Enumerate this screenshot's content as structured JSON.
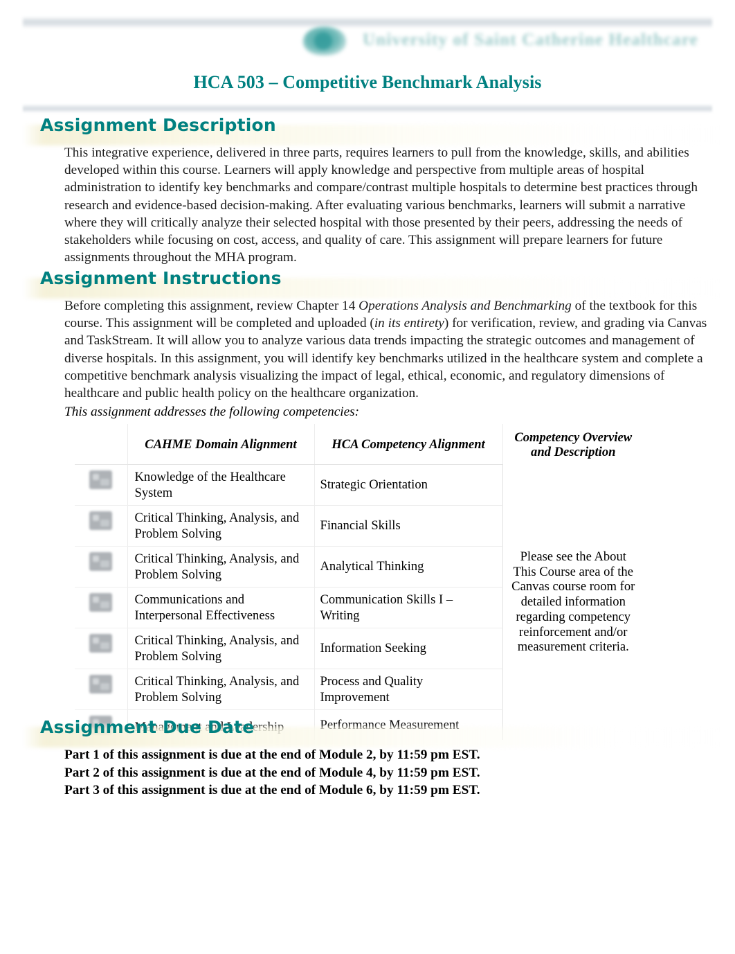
{
  "document": {
    "title": "HCA 503 – Competitive Benchmark Analysis",
    "header_logo_text": "University of Saint Catherine Healthcare",
    "accent_color": "#008080",
    "heading_band_color": "#f6f2d9",
    "rule_color": "#d9dfe4"
  },
  "sections": {
    "description": {
      "heading": "Assignment Description",
      "paragraph": "This integrative experience, delivered in three parts, requires learners to pull from the knowledge, skills, and abilities developed within this course.  Learners will apply knowledge and perspective from multiple areas of hospital administration to identify key benchmarks and compare/contrast multiple hospitals to determine best practices through research and evidence-based decision-making.  After evaluating various benchmarks, learners will submit a narrative where they will critically analyze their selected hospital with those presented by their peers, addressing the needs of stakeholders while focusing on cost, access, and quality of care.  This assignment will prepare learners for future assignments throughout the MHA program."
    },
    "instructions": {
      "heading": "Assignment Instructions",
      "para_part1": "Before completing this assignment, review Chapter 14 ",
      "para_italic1": "Operations Analysis and Benchmarking",
      "para_part2": " of the textbook for this course.  This assignment will be completed and uploaded (",
      "para_italic2": "in its entirety",
      "para_part3": ") for verification, review, and grading via Canvas and TaskStream. It will allow you to analyze various data trends impacting the strategic outcomes and management of diverse hospitals.  In this assignment, you will identify key benchmarks utilized in the healthcare system and complete a competitive benchmark analysis visualizing the impact of legal, ethical, economic, and regulatory dimensions of healthcare and public health policy on the healthcare organization.",
      "competency_intro": "This assignment addresses the following competencies:"
    },
    "due_date": {
      "heading": "Assignment Due Date",
      "lines": [
        "Part 1 of this assignment is due at the end of Module 2, by 11:59 pm EST.",
        "Part 2 of this assignment is due at the end of Module 4, by 11:59 pm EST.",
        "Part 3 of this assignment is due at the end of Module 6, by 11:59 pm EST."
      ]
    }
  },
  "competency_table": {
    "headers": {
      "icon": "",
      "cahme": "CAHME Domain Alignment",
      "hca": "HCA Competency Alignment",
      "overview_line1": "Competency Overview",
      "overview_line2": "and Description"
    },
    "overview_text": "Please see the About This Course area of the Canvas course room for detailed information regarding competency reinforcement and/or measurement criteria.",
    "rows": [
      {
        "icon": "broken-image-icon",
        "cahme": "Knowledge of the Healthcare System",
        "hca": "Strategic Orientation"
      },
      {
        "icon": "broken-image-icon",
        "cahme": "Critical Thinking, Analysis, and Problem Solving",
        "hca": "Financial Skills"
      },
      {
        "icon": "broken-image-icon",
        "cahme": "Critical Thinking, Analysis, and Problem Solving",
        "hca": "Analytical Thinking"
      },
      {
        "icon": "broken-image-icon",
        "cahme": "Communications and Interpersonal Effectiveness",
        "hca": "Communication Skills I – Writing"
      },
      {
        "icon": "broken-image-icon",
        "cahme": "Critical Thinking, Analysis, and Problem Solving",
        "hca": "Information Seeking"
      },
      {
        "icon": "broken-image-icon",
        "cahme": "Critical Thinking, Analysis, and Problem Solving",
        "hca": "Process and Quality Improvement"
      },
      {
        "icon": "broken-image-icon",
        "cahme": "Management and Leadership",
        "hca": "Performance Measurement"
      }
    ]
  }
}
